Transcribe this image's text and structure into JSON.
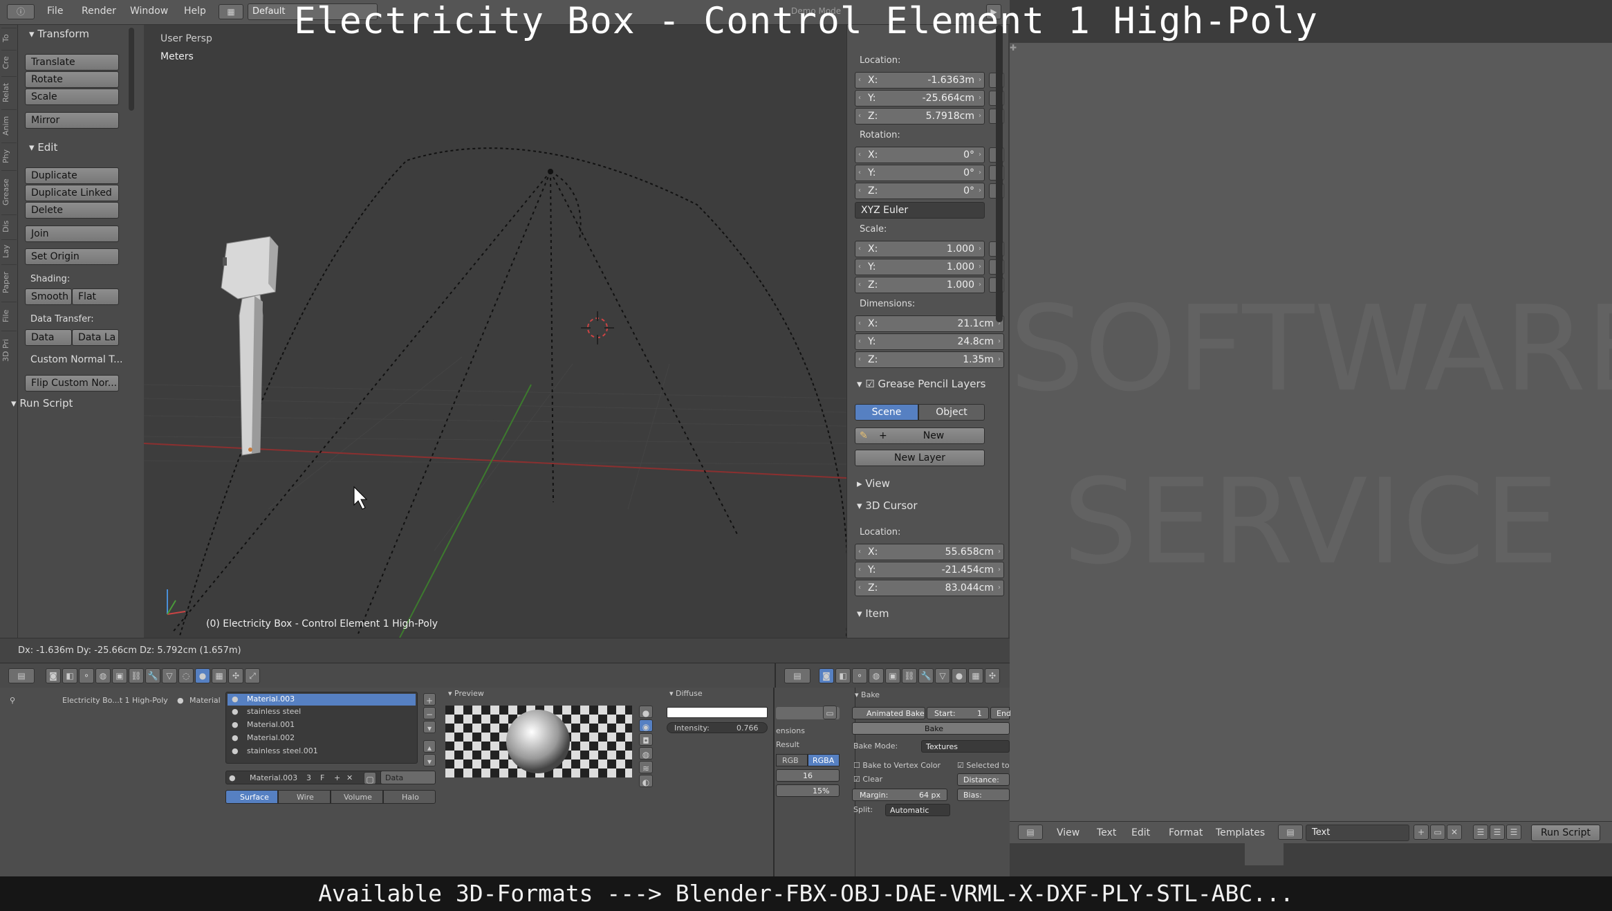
{
  "overlay": {
    "title": "Electricity Box - Control Element 1 High-Poly",
    "bottom": "Available 3D-Formats ---> Blender-FBX-OBJ-DAE-VRML-X-DXF-PLY-STL-ABC..."
  },
  "menubar": {
    "file": "File",
    "render": "Render",
    "window": "Window",
    "help": "Help",
    "layout": "Default",
    "right_hint": "Demo Mode"
  },
  "left_tabs": [
    "To",
    "Cre",
    "Relat",
    "Anim",
    "Phy",
    "Grease",
    "Dis",
    "Lay",
    "Paper",
    "File",
    "3D Pri"
  ],
  "toolshelf": {
    "transform_header": "Transform",
    "translate": "Translate",
    "rotate": "Rotate",
    "scale": "Scale",
    "mirror": "Mirror",
    "edit_header": "Edit",
    "duplicate": "Duplicate",
    "duplicate_linked": "Duplicate Linked",
    "delete": "Delete",
    "join": "Join",
    "set_origin": "Set Origin",
    "shading_label": "Shading:",
    "smooth": "Smooth",
    "flat": "Flat",
    "data_transfer_label": "Data Transfer:",
    "data": "Data",
    "data_la": "Data La",
    "custom_normal": "Custom Normal T...",
    "flip_custom": "Flip Custom Nor...",
    "run_script": "Run Script"
  },
  "viewport": {
    "view_label": "User Persp",
    "units": "Meters",
    "object_label": "(0) Electricity Box - Control Element 1 High-Poly"
  },
  "status": {
    "delta": "Dx: -1.636m  Dy: -25.66cm  Dz: 5.792cm (1.657m)"
  },
  "npanel": {
    "location_label": "Location:",
    "loc_x": "-1.6363m",
    "loc_y": "-25.664cm",
    "loc_z": "5.7918cm",
    "rotation_label": "Rotation:",
    "rot_x": "0°",
    "rot_y": "0°",
    "rot_z": "0°",
    "rot_mode": "XYZ Euler",
    "scale_label": "Scale:",
    "scale_x": "1.000",
    "scale_y": "1.000",
    "scale_z": "1.000",
    "dimensions_label": "Dimensions:",
    "dim_x": "21.1cm",
    "dim_y": "24.8cm",
    "dim_z": "1.35m",
    "grease_header": "Grease Pencil Layers",
    "scene_tab": "Scene",
    "object_tab": "Object",
    "new": "New",
    "new_layer": "New Layer",
    "view_header": "View",
    "cursor_header": "3D Cursor",
    "cursor_location_label": "Location:",
    "cur_x": "55.658cm",
    "cur_y": "-21.454cm",
    "cur_z": "83.044cm",
    "item_header": "Item",
    "axis_x": "X:",
    "axis_y": "Y:",
    "axis_z": "Z:"
  },
  "properties": {
    "breadcrumb_obj": "Electricity Bo...t 1 High-Poly",
    "breadcrumb_mat": "Material",
    "materials": [
      "Material.003",
      "stainless steel",
      "Material.001",
      "Material.002",
      "stainless steel.001"
    ],
    "active_material": "Material.003",
    "user_count": "3",
    "f_label": "F",
    "link_option": "Data",
    "surface_tabs": [
      "Surface",
      "Wire",
      "Volume",
      "Halo"
    ],
    "preview_header": "Preview",
    "diffuse_header": "Diffuse",
    "intensity_label": "Intensity:",
    "intensity_value": "0.766",
    "dimensions_frag": "ensions",
    "result_frag": "Result",
    "rgb": "RGB",
    "rgba": "RGBA",
    "field_16": "16",
    "field_pct": "15%",
    "bake_header": "Bake",
    "animated_bake": "Animated Bake",
    "start_label": "Start:",
    "start_value": "1",
    "end_label": "End",
    "bake_btn": "Bake",
    "bake_mode_label": "Bake Mode:",
    "bake_mode_value": "Textures",
    "bake_vertex": "Bake to Vertex Color",
    "selected_to": "Selected to",
    "clear": "Clear",
    "distance": "Distance:",
    "margin_label": "Margin:",
    "margin_value": "64 px",
    "bias": "Bias:",
    "split_label": "Split:",
    "split_value": "Automatic"
  },
  "text_editor": {
    "view": "View",
    "text": "Text",
    "edit": "Edit",
    "format": "Format",
    "templates": "Templates",
    "datablock": "Text",
    "run_script": "Run Script"
  },
  "watermark": {
    "line1": "SOFTWARE",
    "line2": "SERVICE"
  },
  "colors": {
    "accent_blue": "#5680c2",
    "grid_red": "#8a3030",
    "grid_green": "#3d7a2e"
  }
}
